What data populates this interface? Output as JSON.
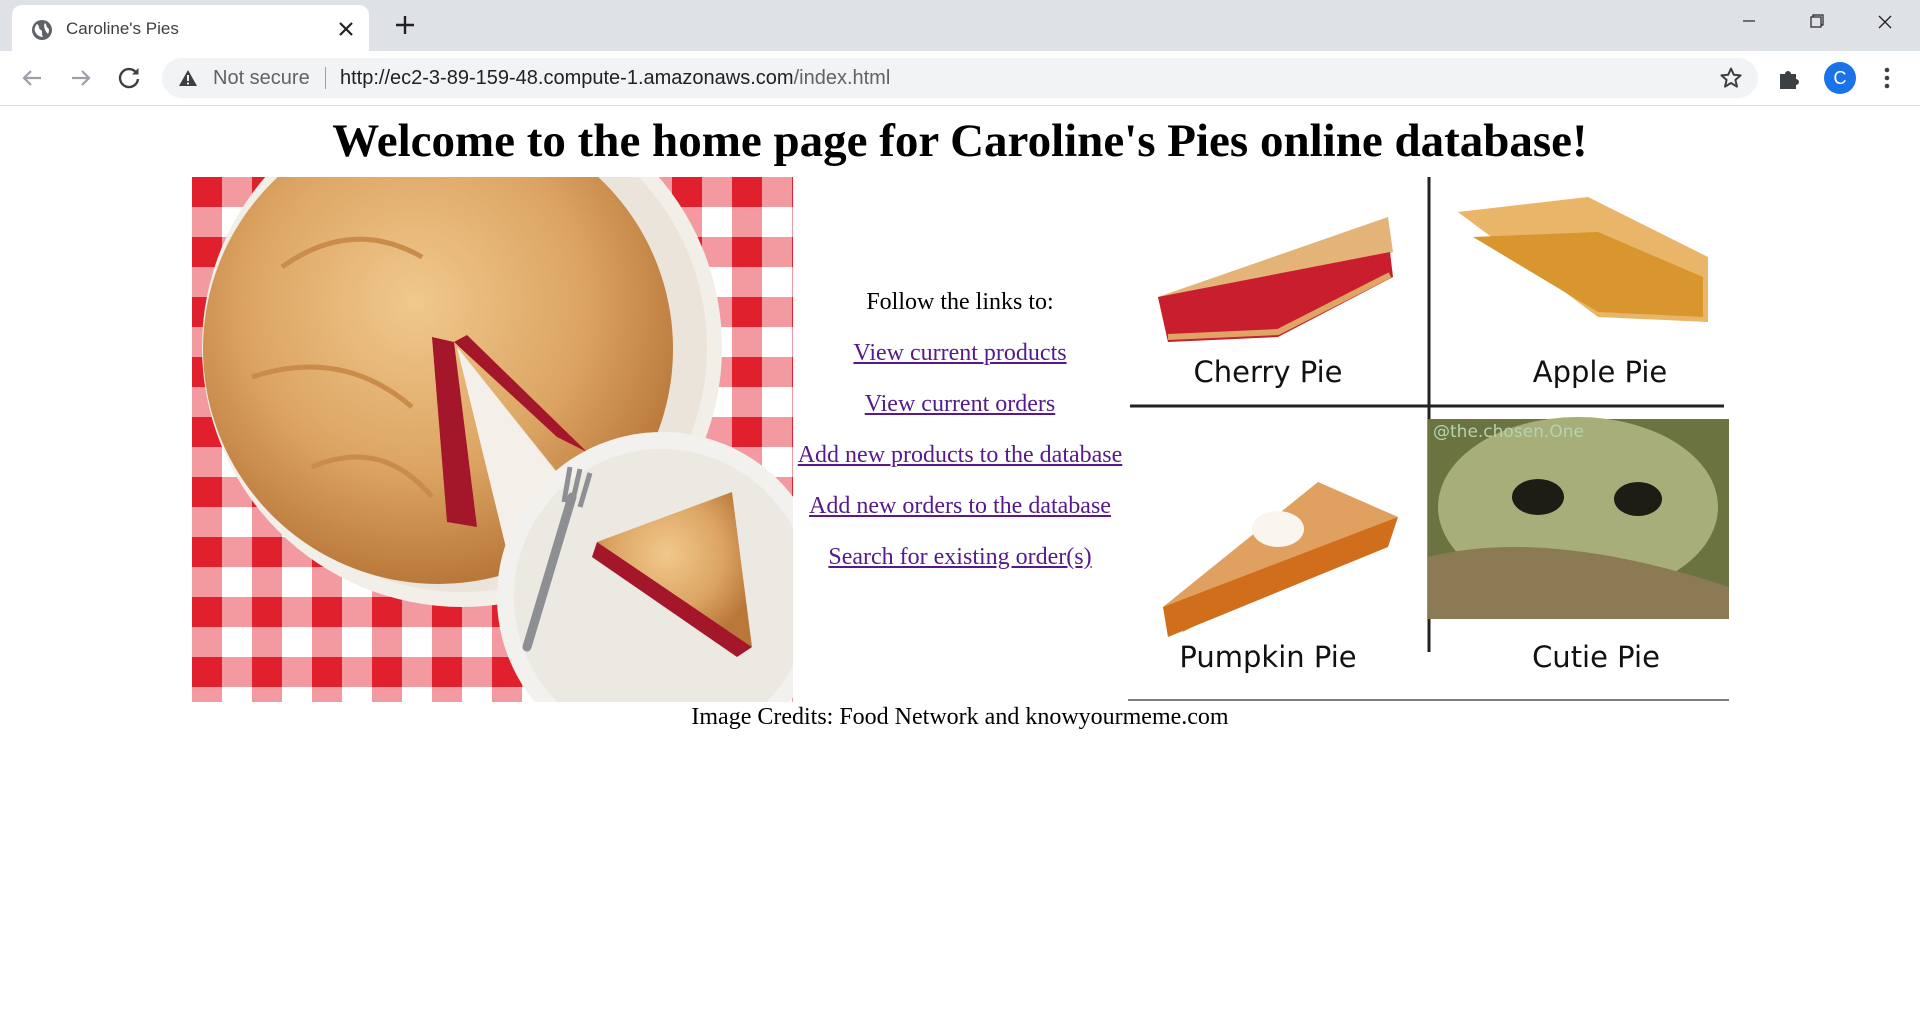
{
  "browser": {
    "tab_title": "Caroline's Pies",
    "security_label": "Not secure",
    "url_host": "http://ec2-3-89-159-48.compute-1.amazonaws.com",
    "url_path": "/index.html",
    "profile_initial": "C"
  },
  "page": {
    "heading": "Welcome to the home page for Caroline's Pies online database!",
    "links_intro": "Follow the links to:",
    "links": [
      "View current products",
      "View current orders",
      "Add new products to the database",
      "Add new orders to the database",
      "Search for existing order(s)"
    ],
    "credits": "Image Credits: Food Network and knowyourmeme.com",
    "meme": {
      "cherry": "Cherry Pie",
      "apple": "Apple Pie",
      "pumpkin": "Pumpkin Pie",
      "cutie": "Cutie Pie",
      "watermark": "@the.chosen.One"
    }
  },
  "colors": {
    "link": "#551a8b",
    "tabstrip": "#dee1e6",
    "omnibox": "#f1f3f4",
    "avatar": "#1a73e8",
    "gingham_red": "#e0202c"
  }
}
